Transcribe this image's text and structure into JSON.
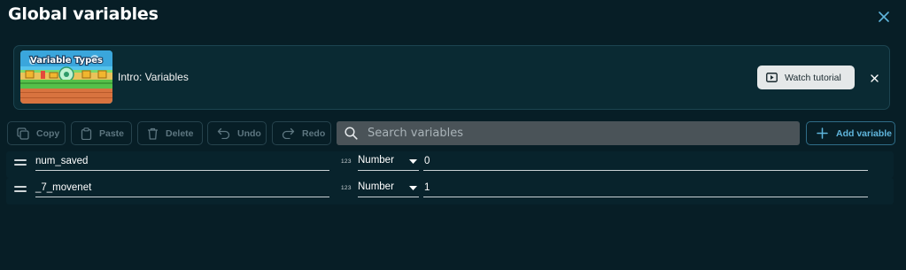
{
  "dialog": {
    "title": "Global variables",
    "close_icon": "close-icon"
  },
  "banner": {
    "thumbnail_text": "Variable Types",
    "text": "Intro: Variables",
    "watch_label": "Watch tutorial",
    "play_icon": "play-icon",
    "close_icon": "close-icon"
  },
  "toolbar": {
    "copy_label": "Copy",
    "paste_label": "Paste",
    "delete_label": "Delete",
    "undo_label": "Undo",
    "redo_label": "Redo",
    "search_placeholder": "Search variables",
    "add_label": "Add variable"
  },
  "variables": [
    {
      "name": "num_saved",
      "type_icon": "123",
      "type": "Number",
      "value": "0"
    },
    {
      "name": "_7_movenet",
      "type_icon": "123",
      "type": "Number",
      "value": "1"
    }
  ],
  "colors": {
    "background": "#071e26",
    "accent": "#5fb5dc"
  }
}
